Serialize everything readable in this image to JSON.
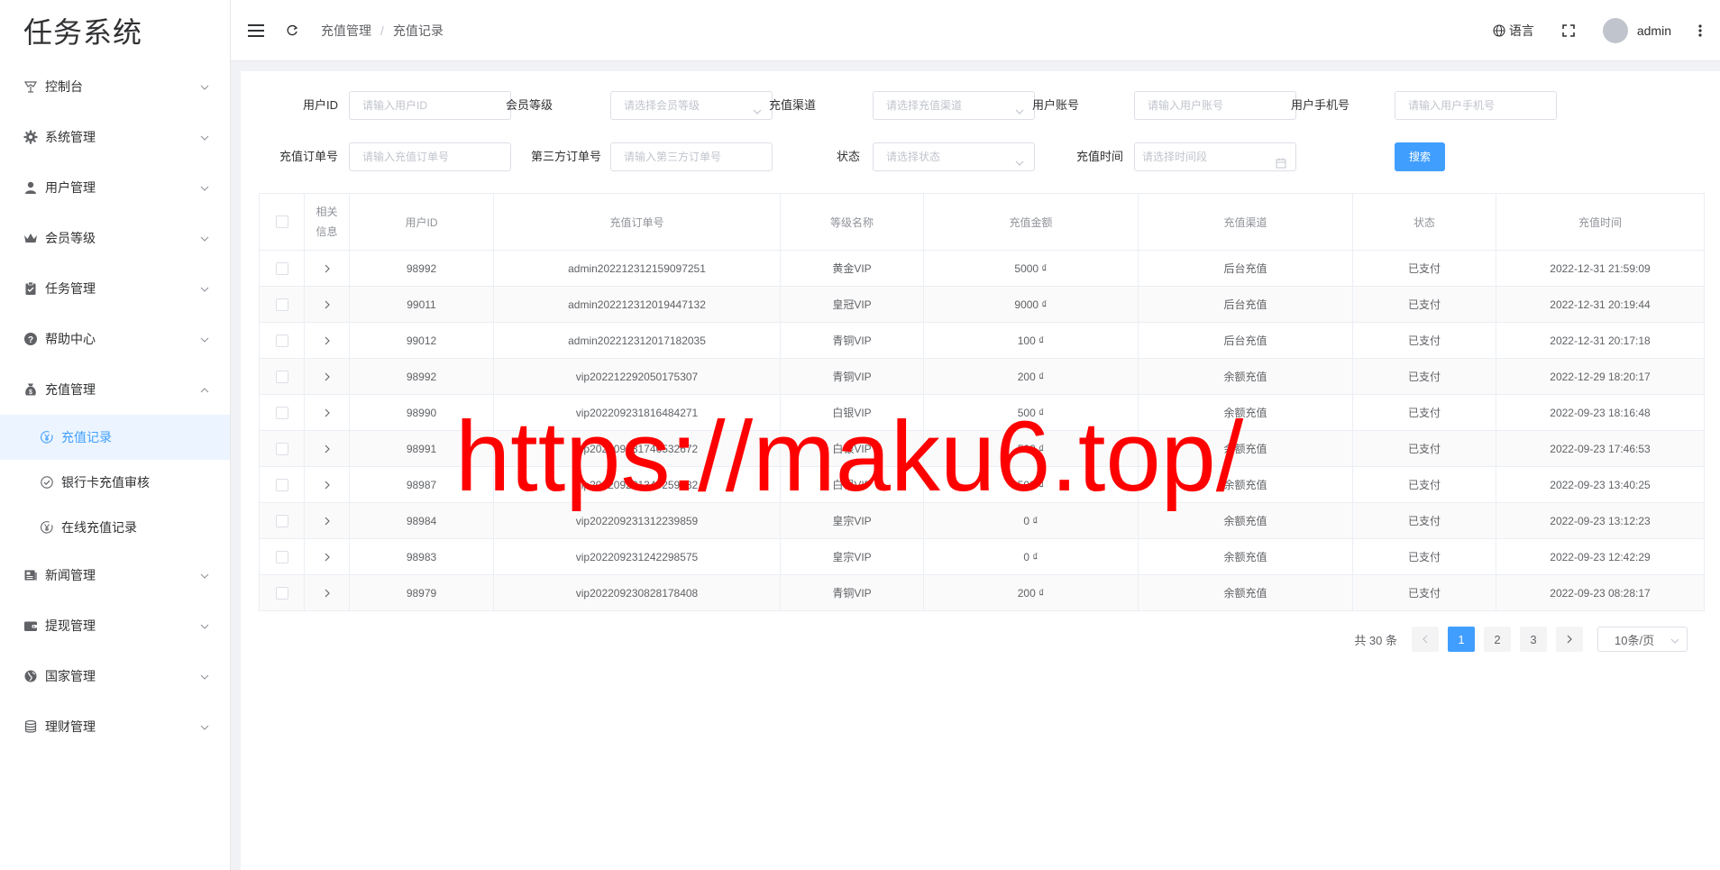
{
  "app": {
    "title": "任务系统"
  },
  "sidebar": {
    "items": [
      {
        "label": "控制台",
        "icon": "dashboard-icon",
        "expanded": false
      },
      {
        "label": "系统管理",
        "icon": "gear-icon",
        "expanded": false
      },
      {
        "label": "用户管理",
        "icon": "user-icon",
        "expanded": false
      },
      {
        "label": "会员等级",
        "icon": "crown-icon",
        "expanded": false
      },
      {
        "label": "任务管理",
        "icon": "clipboard-icon",
        "expanded": false
      },
      {
        "label": "帮助中心",
        "icon": "question-icon",
        "expanded": false
      },
      {
        "label": "充值管理",
        "icon": "money-bag-icon",
        "expanded": true
      },
      {
        "label": "新闻管理",
        "icon": "news-icon",
        "expanded": false
      },
      {
        "label": "提现管理",
        "icon": "wallet-icon",
        "expanded": false
      },
      {
        "label": "国家管理",
        "icon": "globe-icon",
        "expanded": false
      },
      {
        "label": "理财管理",
        "icon": "coins-icon",
        "expanded": false
      }
    ],
    "recharge_sub": [
      {
        "label": "充值记录",
        "icon": "yen-circle-icon",
        "active": true
      },
      {
        "label": "银行卡充值审核",
        "icon": "check-circle-icon",
        "active": false
      },
      {
        "label": "在线充值记录",
        "icon": "yen-circle-icon",
        "active": false
      }
    ]
  },
  "header": {
    "breadcrumb": [
      "充值管理",
      "充值记录"
    ],
    "language_label": "语言",
    "username": "admin"
  },
  "filters": {
    "user_id": {
      "label": "用户ID",
      "placeholder": "请输入用户ID"
    },
    "member_level": {
      "label": "会员等级",
      "placeholder": "请选择会员等级"
    },
    "channel": {
      "label": "充值渠道",
      "placeholder": "请选择充值渠道"
    },
    "account": {
      "label": "用户账号",
      "placeholder": "请输入用户账号"
    },
    "phone": {
      "label": "用户手机号",
      "placeholder": "请输入用户手机号"
    },
    "order_no": {
      "label": "充值订单号",
      "placeholder": "请输入充值订单号"
    },
    "third_order_no": {
      "label": "第三方订单号",
      "placeholder": "请输入第三方订单号"
    },
    "status": {
      "label": "状态",
      "placeholder": "请选择状态"
    },
    "time": {
      "label": "充值时间",
      "placeholder": "请选择时间段"
    },
    "search_label": "搜索"
  },
  "table": {
    "headers": [
      "相关信息",
      "用户ID",
      "充值订单号",
      "等级名称",
      "充值金额",
      "充值渠道",
      "状态",
      "充值时间"
    ],
    "rows": [
      {
        "user_id": "98992",
        "order_no": "admin202212312159097251",
        "level": "黄金VIP",
        "amount": "5000 ₫",
        "channel": "后台充值",
        "status": "已支付",
        "time": "2022-12-31 21:59:09"
      },
      {
        "user_id": "99011",
        "order_no": "admin202212312019447132",
        "level": "皇冠VIP",
        "amount": "9000 ₫",
        "channel": "后台充值",
        "status": "已支付",
        "time": "2022-12-31 20:19:44"
      },
      {
        "user_id": "99012",
        "order_no": "admin202212312017182035",
        "level": "青铜VIP",
        "amount": "100 ₫",
        "channel": "后台充值",
        "status": "已支付",
        "time": "2022-12-31 20:17:18"
      },
      {
        "user_id": "98992",
        "order_no": "vip202212292050175307",
        "level": "青铜VIP",
        "amount": "200 ₫",
        "channel": "余额充值",
        "status": "已支付",
        "time": "2022-12-29 18:20:17"
      },
      {
        "user_id": "98990",
        "order_no": "vip202209231816484271",
        "level": "白银VIP",
        "amount": "500 ₫",
        "channel": "余额充值",
        "status": "已支付",
        "time": "2022-09-23 18:16:48"
      },
      {
        "user_id": "98991",
        "order_no": "vip202209231746532672",
        "level": "白银VIP",
        "amount": "500 ₫",
        "channel": "余额充值",
        "status": "已支付",
        "time": "2022-09-23 17:46:53"
      },
      {
        "user_id": "98987",
        "order_no": "vip202209231340259132",
        "level": "白银VIP",
        "amount": "500 ₫",
        "channel": "余额充值",
        "status": "已支付",
        "time": "2022-09-23 13:40:25"
      },
      {
        "user_id": "98984",
        "order_no": "vip202209231312239859",
        "level": "皇宗VIP",
        "amount": "0 ₫",
        "channel": "余额充值",
        "status": "已支付",
        "time": "2022-09-23 13:12:23"
      },
      {
        "user_id": "98983",
        "order_no": "vip202209231242298575",
        "level": "皇宗VIP",
        "amount": "0 ₫",
        "channel": "余额充值",
        "status": "已支付",
        "time": "2022-09-23 12:42:29"
      },
      {
        "user_id": "98979",
        "order_no": "vip202209230828178408",
        "level": "青铜VIP",
        "amount": "200 ₫",
        "channel": "余额充值",
        "status": "已支付",
        "time": "2022-09-23 08:28:17"
      }
    ]
  },
  "pagination": {
    "total_label": "共 30 条",
    "pages": [
      "1",
      "2",
      "3"
    ],
    "current": "1",
    "page_size_label": "10条/页"
  },
  "watermark": {
    "text": "https://maku6.top/"
  },
  "colors": {
    "accent": "#409eff",
    "watermark": "#ff0000"
  }
}
